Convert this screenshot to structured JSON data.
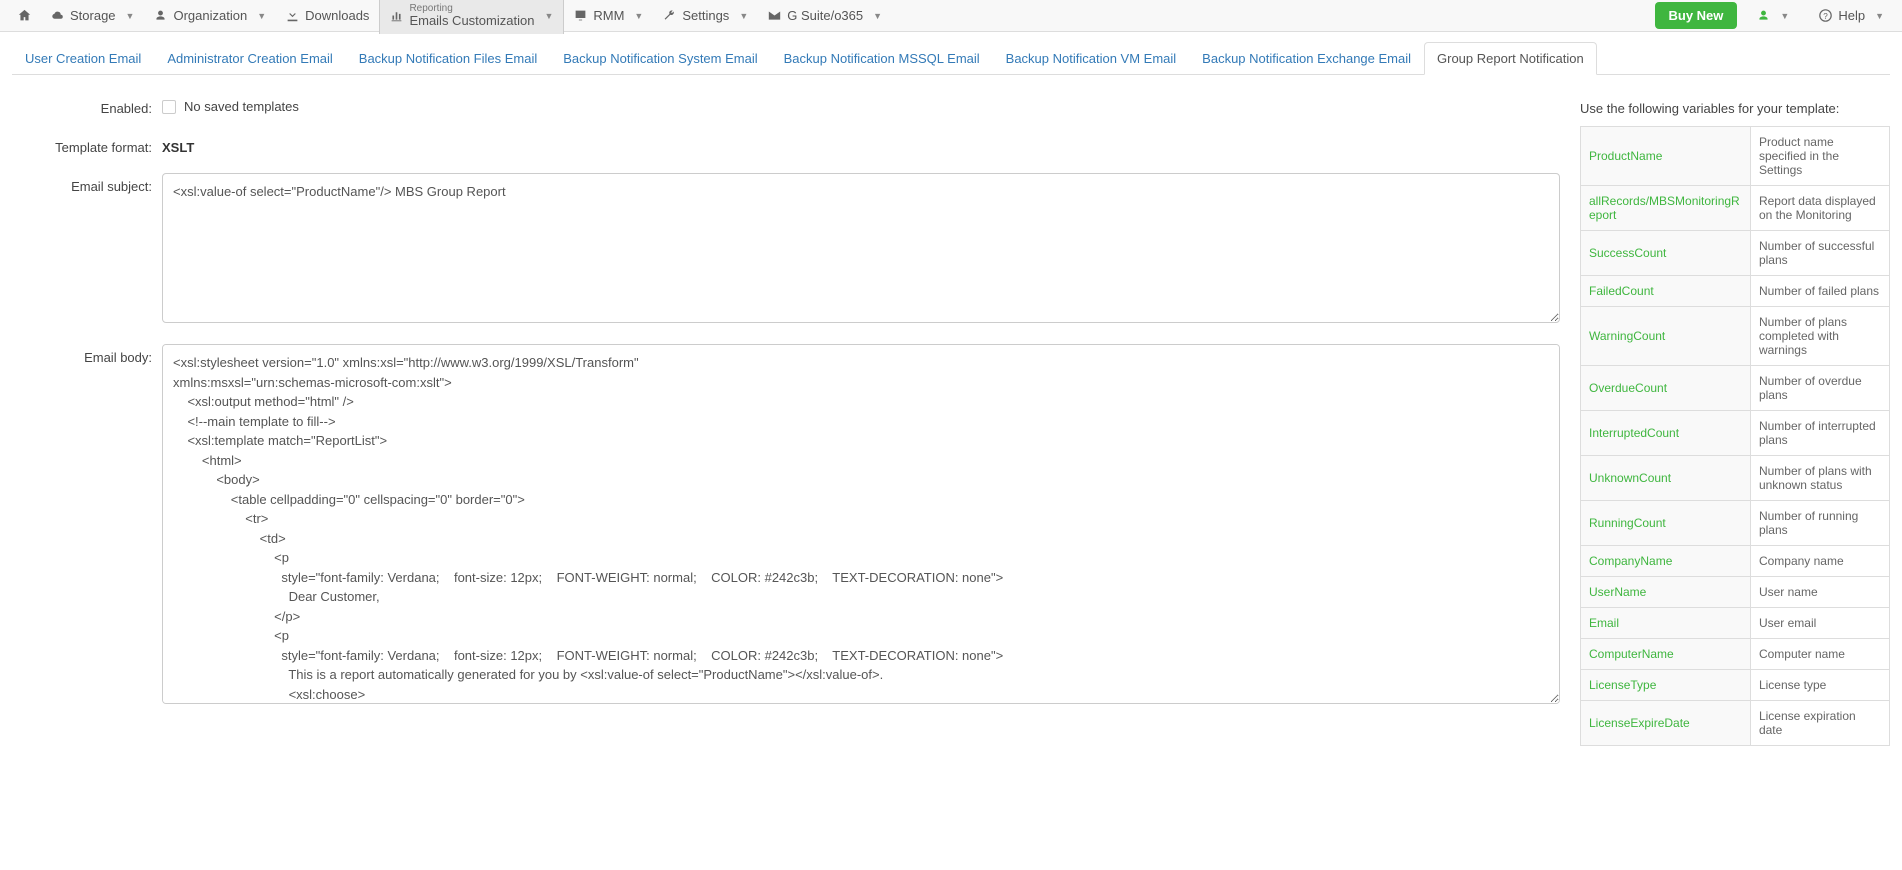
{
  "navbar": {
    "storage": "Storage",
    "organization": "Organization",
    "downloads": "Downloads",
    "reporting_small": "Reporting",
    "reporting_sub": "Emails Customization",
    "rmm": "RMM",
    "settings": "Settings",
    "gsuite": "G Suite/o365",
    "buy_new": "Buy New",
    "help": "Help"
  },
  "tabs": [
    "User Creation Email",
    "Administrator Creation Email",
    "Backup Notification Files Email",
    "Backup Notification System Email",
    "Backup Notification MSSQL Email",
    "Backup Notification VM Email",
    "Backup Notification Exchange Email",
    "Group Report Notification"
  ],
  "form": {
    "enabled_label": "Enabled:",
    "enabled_text": "No saved templates",
    "template_format_label": "Template format:",
    "template_format_value": "XSLT",
    "email_subject_label": "Email subject:",
    "email_subject_value": "<xsl:value-of select=\"ProductName\"/> MBS Group Report",
    "email_body_label": "Email body:",
    "email_body_value": "<xsl:stylesheet version=\"1.0\" xmlns:xsl=\"http://www.w3.org/1999/XSL/Transform\"\nxmlns:msxsl=\"urn:schemas-microsoft-com:xslt\">\n    <xsl:output method=\"html\" />\n    <!--main template to fill-->\n    <xsl:template match=\"ReportList\">\n        <html>\n            <body>\n                <table cellpadding=\"0\" cellspacing=\"0\" border=\"0\">\n                    <tr>\n                        <td>\n                            <p\n                              style=\"font-family: Verdana;    font-size: 12px;    FONT-WEIGHT: normal;    COLOR: #242c3b;    TEXT-DECORATION: none\">\n                                Dear Customer,\n                            </p>\n                            <p\n                              style=\"font-family: Verdana;    font-size: 12px;    FONT-WEIGHT: normal;    COLOR: #242c3b;    TEXT-DECORATION: none\">\n                                This is a report automatically generated for you by <xsl:value-of select=\"ProductName\"></xsl:value-of>.\n                                <xsl:choose>\n                                    <xsl:when test=\"isOverdue='False'\">\n                                        The report contains last run status for backup plans on all your computers.\n                                    </xsl:when>\n                                    <xsl:otherwise>"
  },
  "vars": {
    "title": "Use the following variables for your template:",
    "rows": [
      {
        "name": "ProductName",
        "desc": "Product name specified in the Settings"
      },
      {
        "name": "allRecords/MBSMonitoringReport",
        "desc": "Report data displayed on the Monitoring"
      },
      {
        "name": "SuccessCount",
        "desc": "Number of successful plans"
      },
      {
        "name": "FailedCount",
        "desc": "Number of failed plans"
      },
      {
        "name": "WarningCount",
        "desc": "Number of plans completed with warnings"
      },
      {
        "name": "OverdueCount",
        "desc": "Number of overdue plans"
      },
      {
        "name": "InterruptedCount",
        "desc": "Number of interrupted plans"
      },
      {
        "name": "UnknownCount",
        "desc": "Number of plans with unknown status"
      },
      {
        "name": "RunningCount",
        "desc": "Number of running plans"
      },
      {
        "name": "CompanyName",
        "desc": "Company name"
      },
      {
        "name": "UserName",
        "desc": "User name"
      },
      {
        "name": "Email",
        "desc": "User email"
      },
      {
        "name": "ComputerName",
        "desc": "Computer name"
      },
      {
        "name": "LicenseType",
        "desc": "License type"
      },
      {
        "name": "LicenseExpireDate",
        "desc": "License expiration date"
      }
    ]
  }
}
